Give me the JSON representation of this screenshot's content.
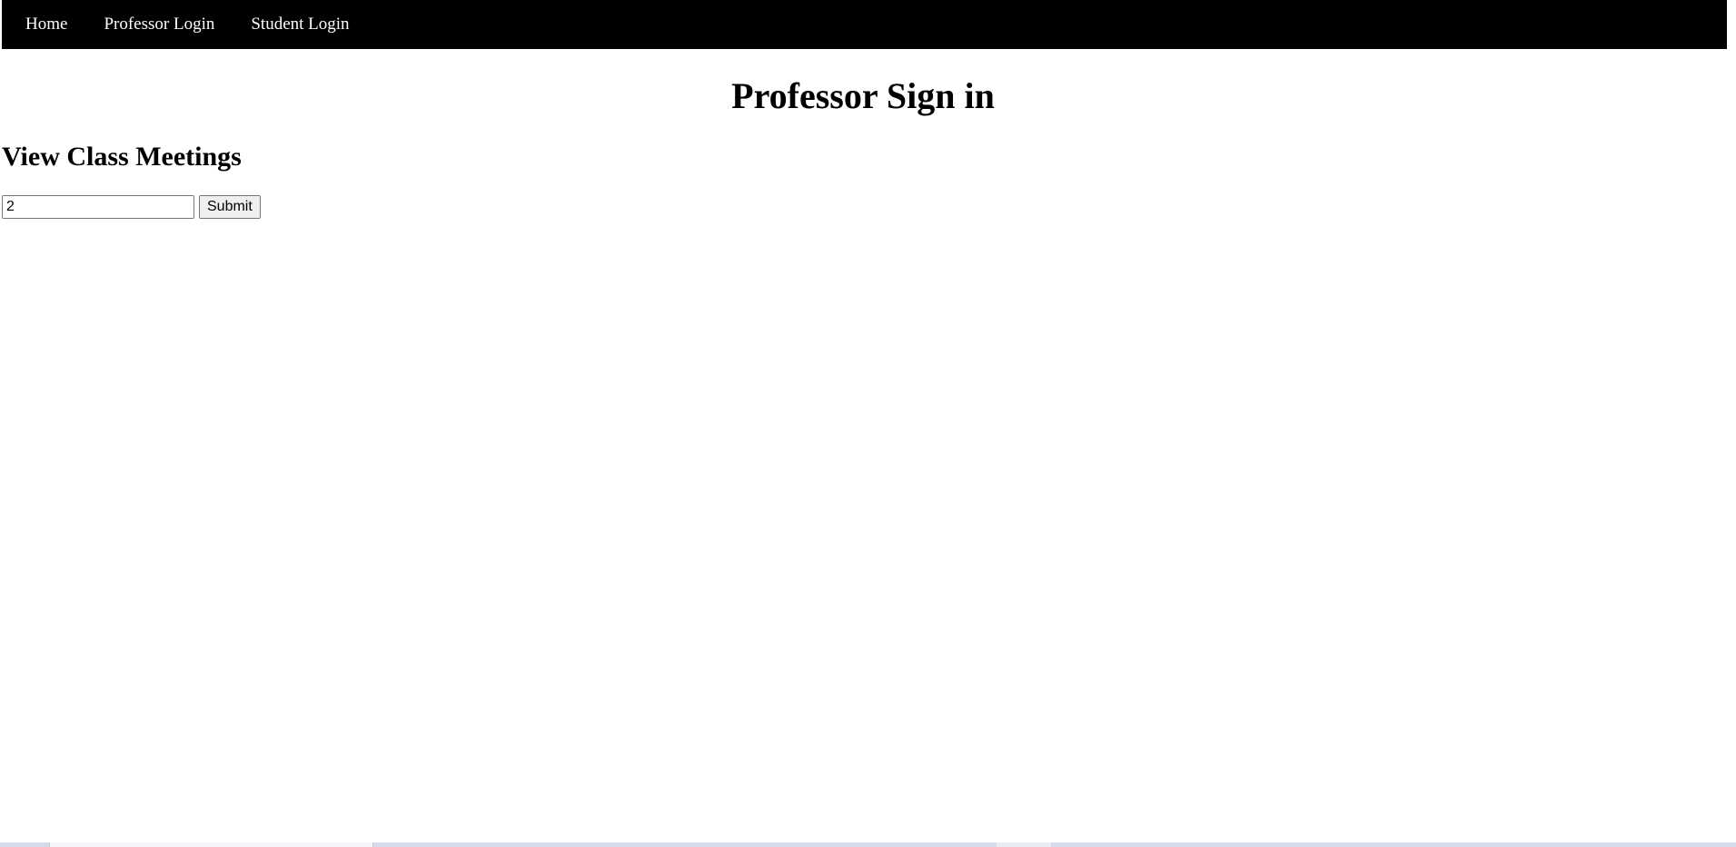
{
  "nav": {
    "items": [
      {
        "label": "Home"
      },
      {
        "label": "Professor Login"
      },
      {
        "label": "Student Login"
      }
    ]
  },
  "page": {
    "title": "Professor Sign in",
    "section_title": "View Class Meetings"
  },
  "form": {
    "class_input_value": "2",
    "submit_label": "Submit"
  }
}
